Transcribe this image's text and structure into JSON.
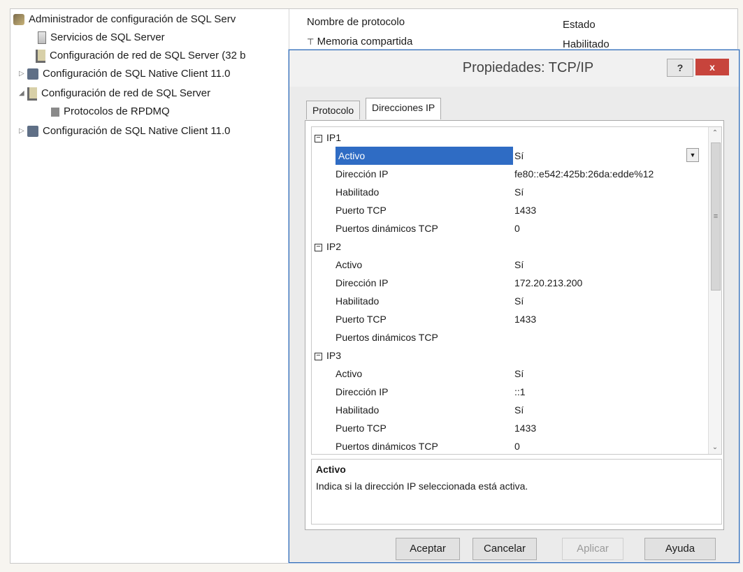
{
  "tree": [
    {
      "label": "Administrador de configuración de SQL Serv",
      "icon": "sql-config-manager-icon"
    },
    {
      "label": "Servicios de SQL Server",
      "icon": "services-icon"
    },
    {
      "label": "Configuración de red de SQL Server (32 b",
      "icon": "network-config-icon"
    },
    {
      "label": "Configuración de SQL Native Client 11.0",
      "icon": "native-client-icon"
    },
    {
      "label": "Configuración de red de SQL Server",
      "icon": "network-config-icon"
    },
    {
      "label": "Protocolos de RPDMQ",
      "icon": "protocols-icon"
    },
    {
      "label": "Configuración de SQL Native Client 11.0",
      "icon": "native-client-icon"
    }
  ],
  "list": {
    "col_name": "Nombre de protocolo",
    "col_state": "Estado",
    "row_name": "Memoria compartida",
    "row_state": "Habilitado"
  },
  "dialog": {
    "title": "Propiedades: TCP/IP",
    "help": "?",
    "close": "x",
    "tabs": [
      "Protocolo",
      "Direcciones IP"
    ],
    "groups": [
      {
        "name": "IP1",
        "props": [
          {
            "k": "Activo",
            "v": "Sí"
          },
          {
            "k": "Dirección IP",
            "v": "fe80::e542:425b:26da:edde%12"
          },
          {
            "k": "Habilitado",
            "v": "Sí"
          },
          {
            "k": "Puerto TCP",
            "v": "1433"
          },
          {
            "k": "Puertos dinámicos TCP",
            "v": "0"
          }
        ]
      },
      {
        "name": "IP2",
        "props": [
          {
            "k": "Activo",
            "v": "Sí"
          },
          {
            "k": "Dirección IP",
            "v": "172.20.213.200"
          },
          {
            "k": "Habilitado",
            "v": "Sí"
          },
          {
            "k": "Puerto TCP",
            "v": "1433"
          },
          {
            "k": "Puertos dinámicos TCP",
            "v": ""
          }
        ]
      },
      {
        "name": "IP3",
        "props": [
          {
            "k": "Activo",
            "v": "Sí"
          },
          {
            "k": "Dirección IP",
            "v": "::1"
          },
          {
            "k": "Habilitado",
            "v": "Sí"
          },
          {
            "k": "Puerto TCP",
            "v": "1433"
          },
          {
            "k": "Puertos dinámicos TCP",
            "v": "0"
          }
        ]
      }
    ],
    "desc_title": "Activo",
    "desc_text": "Indica si la dirección IP seleccionada está activa.",
    "buttons": {
      "ok": "Aceptar",
      "cancel": "Cancelar",
      "apply": "Aplicar",
      "help": "Ayuda"
    }
  }
}
